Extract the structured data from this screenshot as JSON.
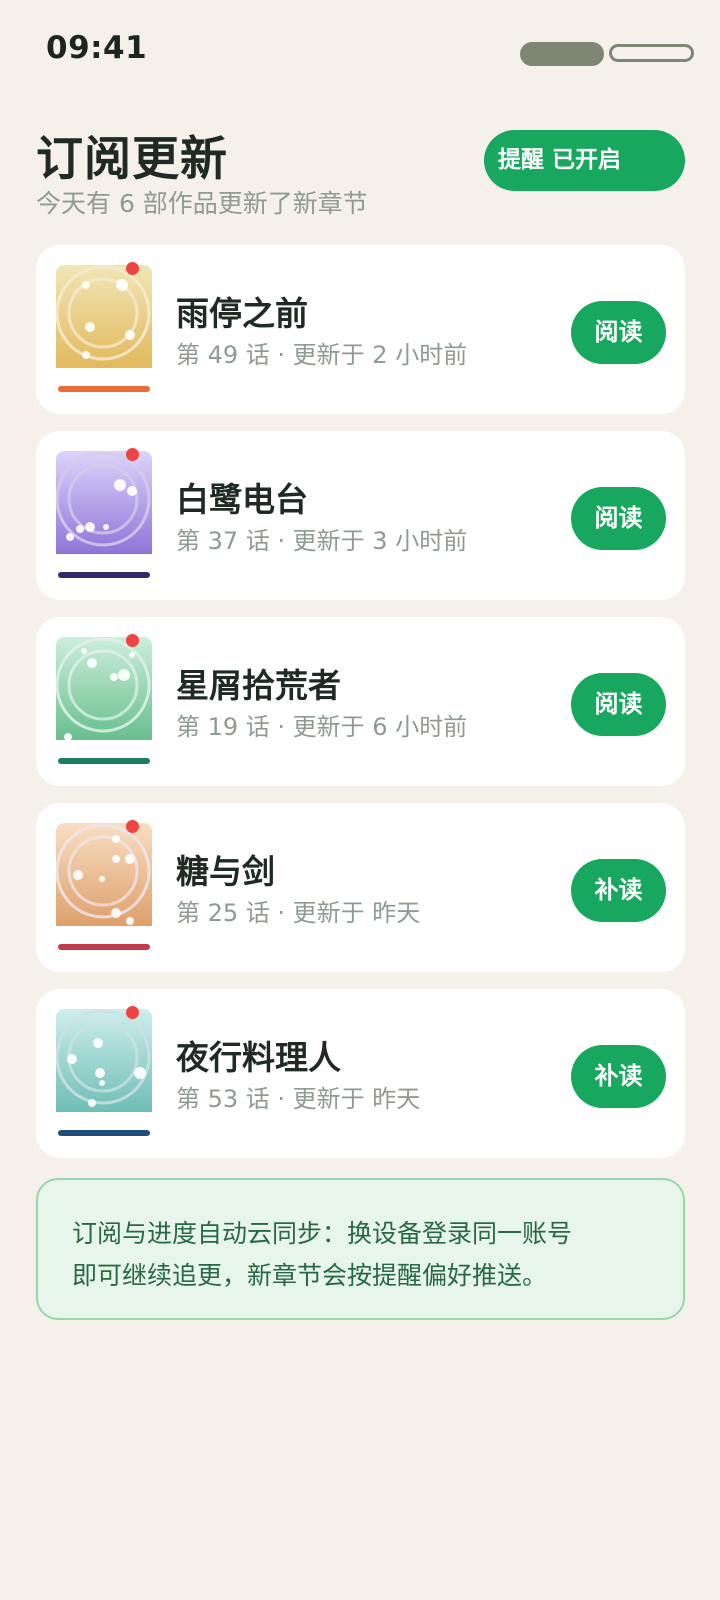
{
  "status_bar": {
    "time": "09:41"
  },
  "header": {
    "title": "订阅更新",
    "subtitle": "今天有 6 部作品更新了新章节",
    "reminder_label": "提醒 已开启"
  },
  "updates": [
    {
      "title": "雨停之前",
      "meta": "第 49 话 · 更新于 2 小时前",
      "action": "阅读",
      "cover_top": "#f1e6b6",
      "cover_bottom": "#e2b95d",
      "ring": "#f4ecd2",
      "bar": "#ec6b36"
    },
    {
      "title": "白鹭电台",
      "meta": "第 37 话 · 更新于 3 小时前",
      "action": "阅读",
      "cover_top": "#dcd4fb",
      "cover_bottom": "#8f74d8",
      "ring": "#d4cde8",
      "bar": "#312a6e"
    },
    {
      "title": "星屑拾荒者",
      "meta": "第 19 话 · 更新于 6 小时前",
      "action": "阅读",
      "cover_top": "#cdeedb",
      "cover_bottom": "#67bf8e",
      "ring": "#e0f1e7",
      "bar": "#1b7e60"
    },
    {
      "title": "糖与剑",
      "meta": "第 25 话 · 更新于 昨天",
      "action": "补读",
      "cover_top": "#f8dec2",
      "cover_bottom": "#dea06b",
      "ring": "#f1e4ec",
      "bar": "#bf3a4a"
    },
    {
      "title": "夜行料理人",
      "meta": "第 53 话 · 更新于 昨天",
      "action": "补读",
      "cover_top": "#cdeeed",
      "cover_bottom": "#6fbeb5",
      "ring": "#cde1e2",
      "bar": "#1f4f7a"
    }
  ],
  "note": {
    "line1": "订阅与进度自动云同步：换设备登录同一账号",
    "line2": "即可继续追更，新章节会按提醒偏好推送。"
  },
  "colors": {
    "background": "#f5f1ea",
    "accent": "#17a75e",
    "new_dot": "#ef4444",
    "note_background": "#e8f5ea",
    "note_border": "#98d7aa"
  }
}
